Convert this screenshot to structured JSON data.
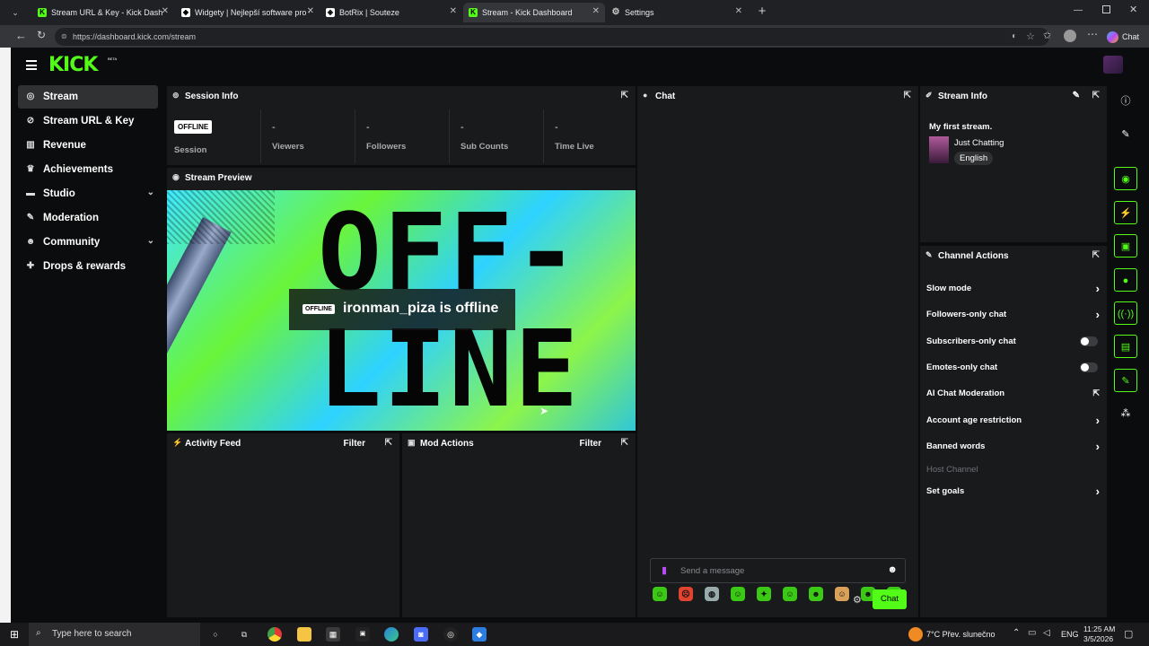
{
  "browser": {
    "tabs": [
      {
        "label": "Stream URL & Key - Kick Dashboa",
        "icon": "kick-icon"
      },
      {
        "label": "Widgety | Nejlepší software pro vy",
        "icon": "widget-icon"
      },
      {
        "label": "BotRix | Souteze",
        "icon": "botrix-icon"
      },
      {
        "label": "Stream - Kick Dashboard",
        "icon": "kick-icon"
      },
      {
        "label": "Settings",
        "icon": "gear-icon"
      }
    ],
    "url": "https://dashboard.kick.com/stream",
    "chat_button": "Chat"
  },
  "brand": {
    "logo": "KICK",
    "beta": "BETA",
    "accent": "#53fc18"
  },
  "sidebar": {
    "items": [
      {
        "label": "Stream",
        "icon": "stream-icon"
      },
      {
        "label": "Stream URL & Key",
        "icon": "link-icon"
      },
      {
        "label": "Revenue",
        "icon": "chart-icon"
      },
      {
        "label": "Achievements",
        "icon": "trophy-icon"
      },
      {
        "label": "Studio",
        "icon": "studio-icon"
      },
      {
        "label": "Moderation",
        "icon": "wrench-icon"
      },
      {
        "label": "Community",
        "icon": "people-icon"
      },
      {
        "label": "Drops & rewards",
        "icon": "gift-icon"
      }
    ]
  },
  "session": {
    "title": "Session Info",
    "status_badge": "OFFLINE",
    "stats": [
      {
        "label": "Session",
        "value": ""
      },
      {
        "label": "Viewers",
        "value": "-"
      },
      {
        "label": "Followers",
        "value": "-"
      },
      {
        "label": "Sub Counts",
        "value": "-"
      },
      {
        "label": "Time Live",
        "value": "-"
      }
    ]
  },
  "preview": {
    "title": "Stream Preview",
    "badge": "OFFLINE",
    "message": "ironman_piza is offline",
    "bg_line1": "OFF-",
    "bg_line2": "LINE"
  },
  "activity": {
    "title": "Activity Feed",
    "filter": "Filter"
  },
  "mod_actions": {
    "title": "Mod Actions",
    "filter": "Filter"
  },
  "chat": {
    "title": "Chat",
    "placeholder": "Send a message",
    "send": "Chat"
  },
  "stream_info": {
    "title": "Stream Info",
    "stream_title": "My first stream.",
    "category": "Just Chatting",
    "language": "English"
  },
  "channel_actions": {
    "title": "Channel Actions",
    "items": [
      {
        "label": "Slow mode",
        "control": "arrow"
      },
      {
        "label": "Followers-only chat",
        "control": "arrow"
      },
      {
        "label": "Subscribers-only chat",
        "control": "toggle",
        "on": false
      },
      {
        "label": "Emotes-only chat",
        "control": "toggle",
        "on": false
      },
      {
        "label": "AI Chat Moderation",
        "control": "external"
      },
      {
        "label": "Account age restriction",
        "control": "arrow"
      },
      {
        "label": "Banned words",
        "control": "arrow"
      },
      {
        "label": "Host Channel",
        "control": "none",
        "disabled": true
      },
      {
        "label": "Set goals",
        "control": "arrow"
      }
    ]
  },
  "taskbar": {
    "search": "Type here to search",
    "weather": "7°C  Přev. slunečno",
    "lang": "ENG",
    "time": "11:25 AM",
    "date": "3/5/2026"
  }
}
